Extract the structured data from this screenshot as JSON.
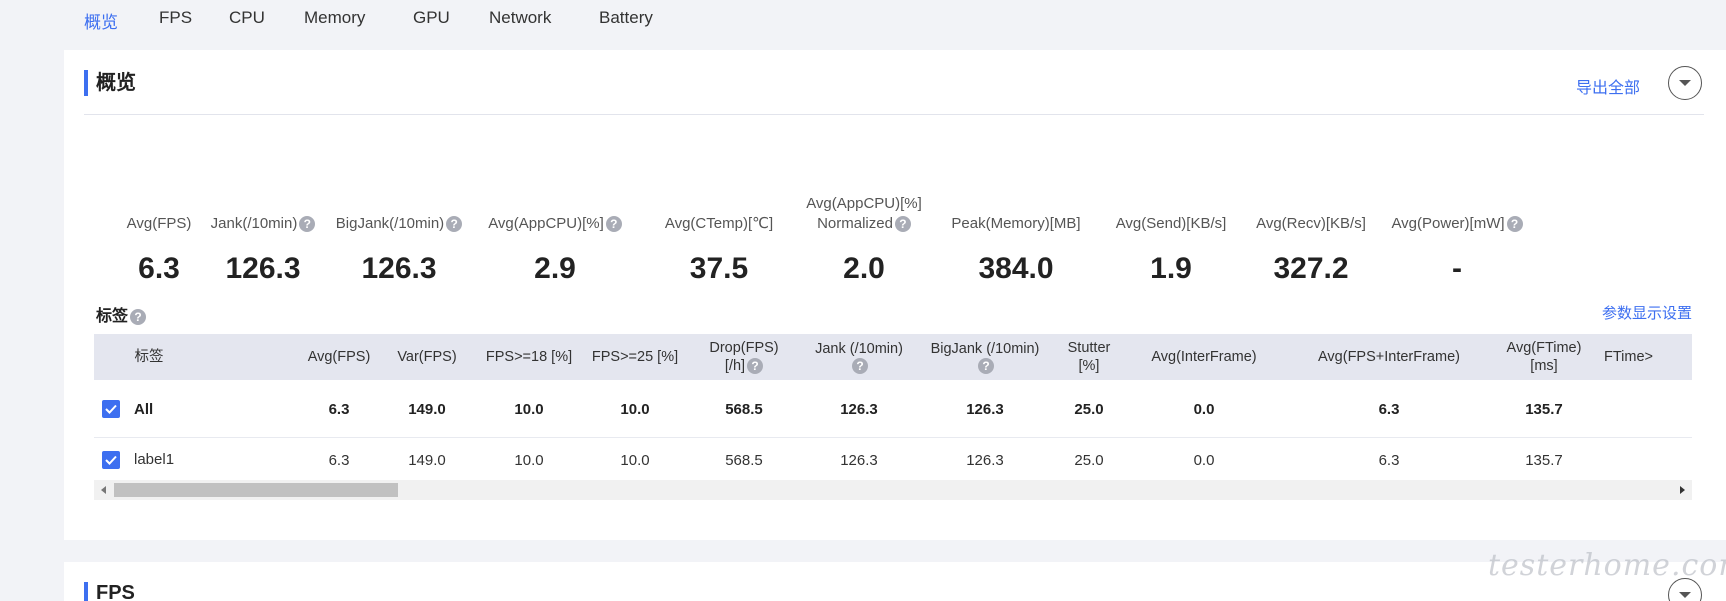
{
  "tabs": [
    {
      "label": "概览",
      "active": true
    },
    {
      "label": "FPS"
    },
    {
      "label": "CPU"
    },
    {
      "label": "Memory"
    },
    {
      "label": "GPU"
    },
    {
      "label": "Network"
    },
    {
      "label": "Battery"
    }
  ],
  "overview": {
    "title": "概览",
    "export_label": "导出全部",
    "metrics": [
      {
        "label": "Avg(FPS)",
        "value": "6.3"
      },
      {
        "label": "Jank(/10min)",
        "value": "126.3"
      },
      {
        "label": "BigJank(/10min)",
        "value": "126.3"
      },
      {
        "label": "Avg(AppCPU)[%]",
        "value": "2.9"
      },
      {
        "label": "Avg(CTemp)[℃]",
        "value": "37.5"
      },
      {
        "label": "Avg(AppCPU)[%]",
        "label2": "Normalized",
        "value": "2.0"
      },
      {
        "label": "Peak(Memory)[MB]",
        "value": "384.0"
      },
      {
        "label": "Avg(Send)[KB/s]",
        "value": "1.9"
      },
      {
        "label": "Avg(Recv)[KB/s]",
        "value": "327.2"
      },
      {
        "label": "Avg(Power)[mW]",
        "value": "-"
      }
    ]
  },
  "tags": {
    "title": "标签",
    "settings_label": "参数显示设置",
    "columns": [
      {
        "line1": "标签"
      },
      {
        "line1": "Avg(FPS)"
      },
      {
        "line1": "Var(FPS)"
      },
      {
        "line1": "FPS>=18 [%]"
      },
      {
        "line1": "FPS>=25 [%]"
      },
      {
        "line1": "Drop(FPS)",
        "line2": "[/h]"
      },
      {
        "line1": "Jank (/10min)"
      },
      {
        "line1": "BigJank (/10min)"
      },
      {
        "line1": "Stutter",
        "line2": "[%]"
      },
      {
        "line1": "Avg(InterFrame)"
      },
      {
        "line1": "Avg(FPS+InterFrame)"
      },
      {
        "line1": "Avg(FTime)",
        "line2": "[ms]"
      },
      {
        "line1": "FTime>"
      }
    ],
    "rows": [
      {
        "label": "All",
        "cells": [
          "6.3",
          "149.0",
          "10.0",
          "10.0",
          "568.5",
          "126.3",
          "126.3",
          "25.0",
          "0.0",
          "6.3",
          "135.7"
        ]
      },
      {
        "label": "label1",
        "cells": [
          "6.3",
          "149.0",
          "10.0",
          "10.0",
          "568.5",
          "126.3",
          "126.3",
          "25.0",
          "0.0",
          "6.3",
          "135.7"
        ]
      }
    ]
  },
  "fps_card": {
    "title": "FPS"
  },
  "watermark": "testerhome.com",
  "colors": {
    "accent": "#3d6ff0",
    "header_bg": "#e4e6ef",
    "page_bg": "#f2f3f7"
  }
}
